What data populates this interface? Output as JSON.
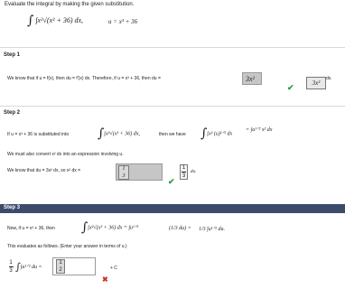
{
  "question": {
    "instruction": "Evaluate the integral by making the given substitution.",
    "integral": "∫x²√(x³ + 36) dx,",
    "substitution": "u = x³ + 36"
  },
  "step1": {
    "label": "Step 1",
    "text": "We know that if u = f(x), then du = f′(x) dx. Therefore, if u = x³ + 36, then du =",
    "answer": "3x²",
    "answer_suffix": "dx.",
    "feedback": "correct"
  },
  "step2": {
    "label": "Step 2",
    "line1_a": "If u = x³ + 36 is substituted into",
    "line1_integral": "∫x²√(x³ + 36) dx,",
    "line1_b": "then we have",
    "line1_c": "∫x² (u)¹ᐟ² dx",
    "line1_d": "= ∫u¹ᐟ² x² dx",
    "line2": "We must also convert x² dx into an expression involving u.",
    "line3": "We know that du = 3x² dx, so x² dx =",
    "answer_num": "1",
    "answer_den": "3",
    "echo_num": "1",
    "echo_den": "3",
    "echo_suffix": "du.",
    "feedback": "correct"
  },
  "step3": {
    "label": "Step 3",
    "line1_a": "Now, if u = x³ + 36, then",
    "line1_b": "∫x²√(x³ + 36) dx = ∫u¹ᐟ²",
    "line1_c": "(1/3 du) =",
    "line1_d": "1/3 ∫u¹ᐟ² du.",
    "line2": "This evaluates as follows. (Enter your answer in terms of u.)",
    "lhs_num": "1",
    "lhs_den": "3",
    "lhs_integral": "∫u¹ᐟ² du =",
    "answer_num": "1",
    "answer_den": "2",
    "plus_c": "+ C",
    "feedback": "incorrect"
  },
  "colors": {
    "step3_header": "#3d4b6b",
    "correct": "#2e9e3e",
    "incorrect": "#d3312b"
  }
}
